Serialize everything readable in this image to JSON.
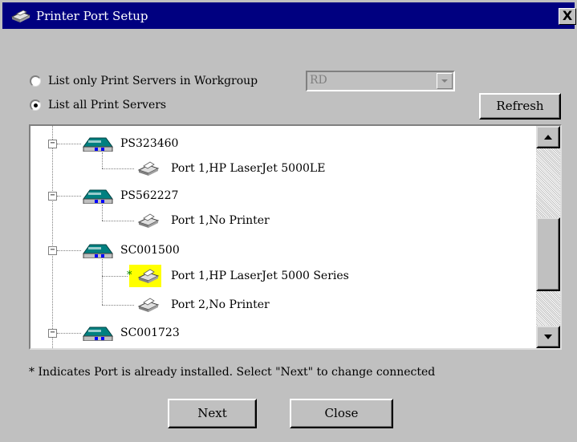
{
  "window": {
    "title": "Printer Port Setup",
    "close_label": "X"
  },
  "options": {
    "workgroup_radio_label": "List only Print Servers in Workgroup",
    "workgroup_radio_checked": false,
    "all_radio_label": "List all Print Servers",
    "all_radio_checked": true,
    "workgroup_value": "RD",
    "refresh_label": "Refresh"
  },
  "tree": {
    "servers": [
      {
        "name": "PS323460",
        "ports": [
          {
            "label": "Port 1,HP LaserJet 5000LE",
            "installed": false
          }
        ]
      },
      {
        "name": "PS562227",
        "ports": [
          {
            "label": "Port 1,No Printer",
            "installed": false
          }
        ]
      },
      {
        "name": "SC001500",
        "ports": [
          {
            "label": "Port 1,HP LaserJet 5000 Series",
            "installed": true
          },
          {
            "label": "Port 2,No Printer",
            "installed": false
          }
        ]
      },
      {
        "name": "SC001723",
        "ports": []
      }
    ],
    "expander_symbol": "−",
    "installed_marker": "*"
  },
  "note": "* Indicates Port is already installed. Select \"Next\" to change connected",
  "buttons": {
    "next_label": "Next",
    "close_label": "Close"
  },
  "colors": {
    "title_bar": "#000080",
    "dialog_bg": "#c0c0c0",
    "highlight": "#ffff00",
    "installed_marker": "#008000"
  }
}
